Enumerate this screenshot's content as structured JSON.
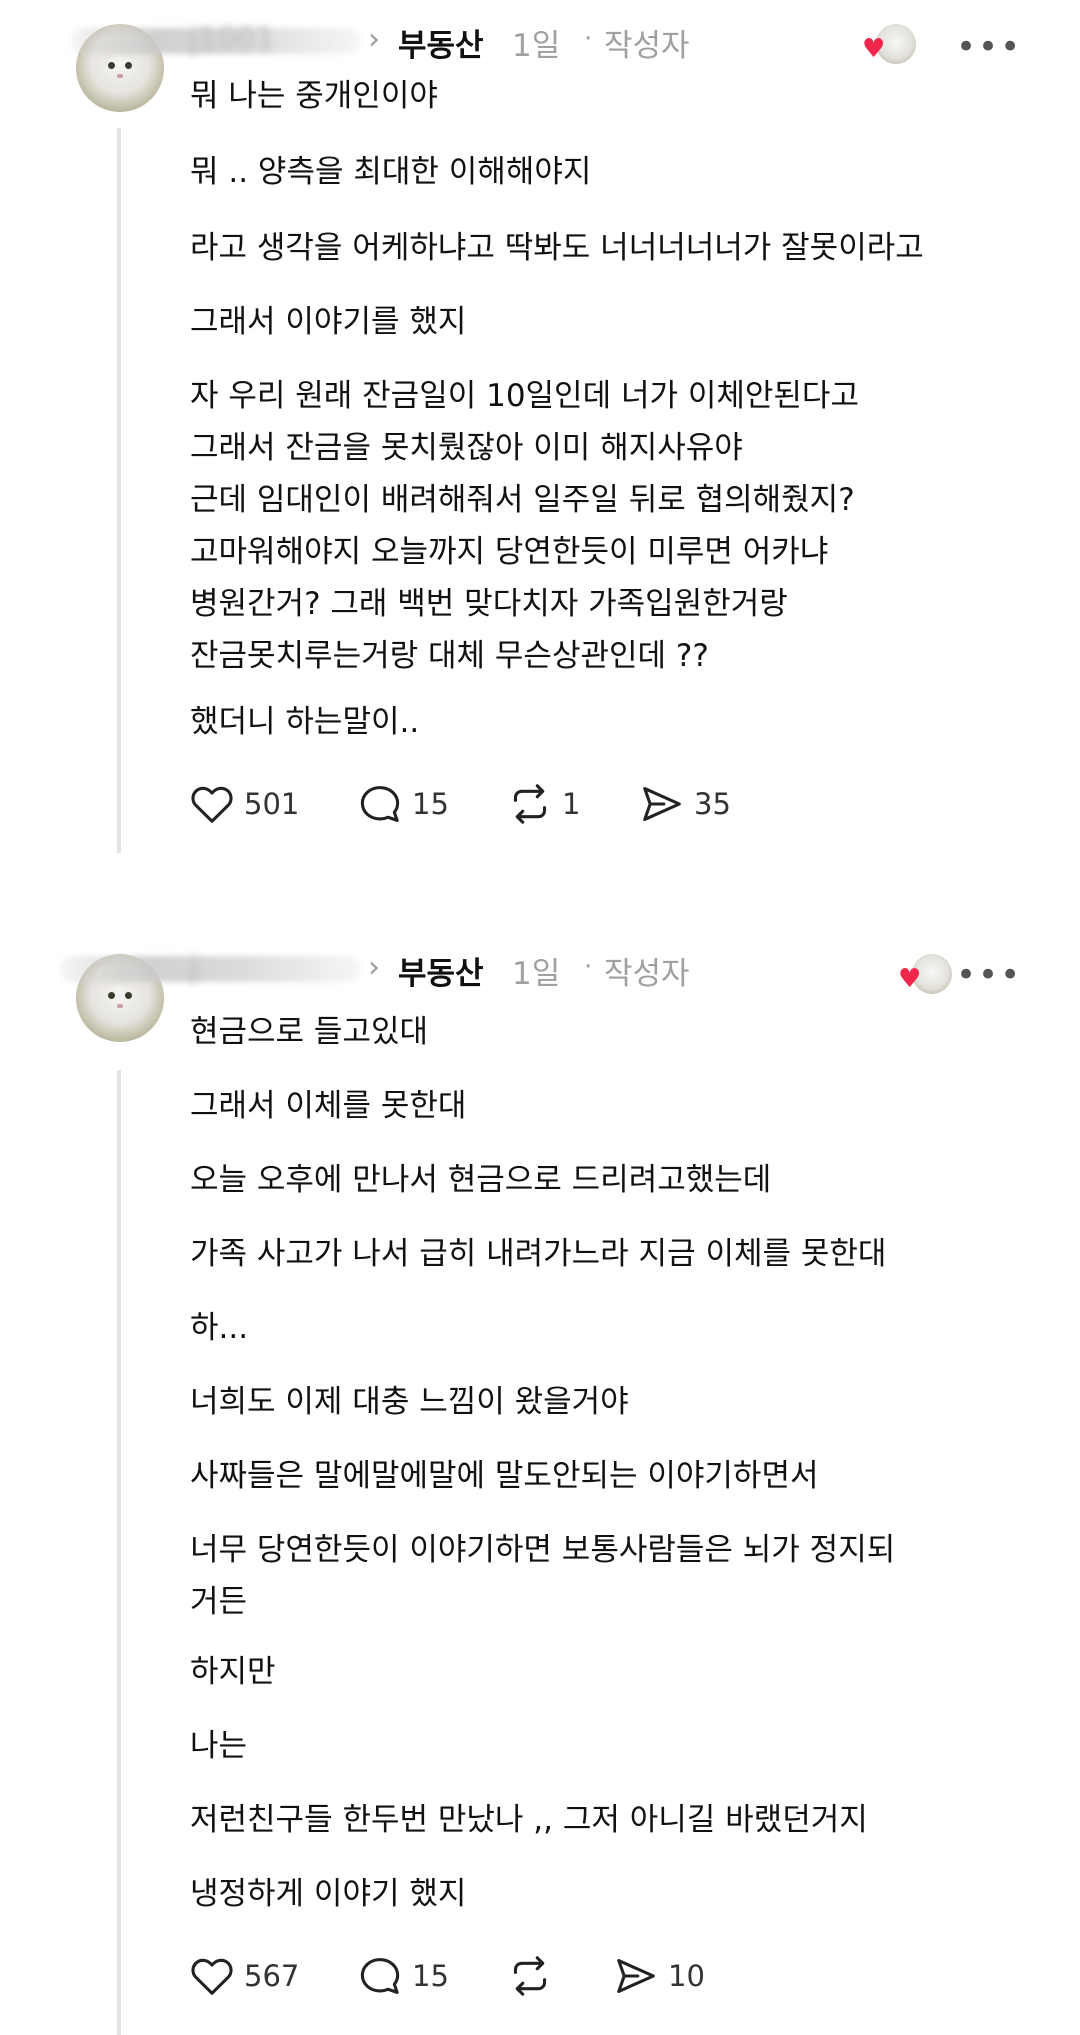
{
  "posts": [
    {
      "username": "j1001",
      "topic": "부동산",
      "age": "1일",
      "separator": "·",
      "author_badge": "작성자",
      "more": "•••",
      "paragraphs": [
        "뭐 나는 중개인이야",
        "뭐 .. 양측을 최대한 이해해야지",
        "라고 생각을 어케하냐고 딱봐도 너너너너너가 잘못이라고",
        "그래서 이야기를 했지",
        "자 우리 원래 잔금일이 10일인데 너가 이체안된다고\n그래서 잔금을 못치뤘잖아 이미 해지사유야\n근데 임대인이 배려해줘서 일주일 뒤로 협의해줬지?\n고마워해야지 오늘까지 당연한듯이 미루면 어카냐\n병원간거? 그래 백번 맞다치자 가족입원한거랑\n잔금못치루는거랑 대체 무슨상관인데 ??",
        "했더니 하는말이.."
      ],
      "actions": {
        "likes": "501",
        "comments": "15",
        "reposts": "1",
        "shares": "35"
      }
    },
    {
      "username": "j",
      "topic": "부동산",
      "age": "1일",
      "separator": "·",
      "author_badge": "작성자",
      "more": "•••",
      "paragraphs": [
        "현금으로 들고있대",
        "그래서 이체를 못한대",
        "오늘 오후에 만나서 현금으로 드리려고했는데",
        "가족 사고가 나서 급히 내려가느라 지금 이체를 못한대",
        "하...",
        "너희도 이제 대충 느낌이 왔을거야",
        "사짜들은 말에말에말에 말도안되는 이야기하면서",
        "너무 당연한듯이 이야기하면 보통사람들은 뇌가 정지되\n거든",
        "하지만",
        "나는",
        "저런친구들 한두번 만났나 ,, 그저 아니길 바랬던거지",
        "냉정하게 이야기 했지"
      ],
      "actions": {
        "likes": "567",
        "comments": "15",
        "reposts": "",
        "shares": "10"
      }
    }
  ],
  "colors": {
    "heart": "#f0264b",
    "muted": "#a0a0a0",
    "text": "#111111",
    "thread_line": "#e3e3e3"
  }
}
